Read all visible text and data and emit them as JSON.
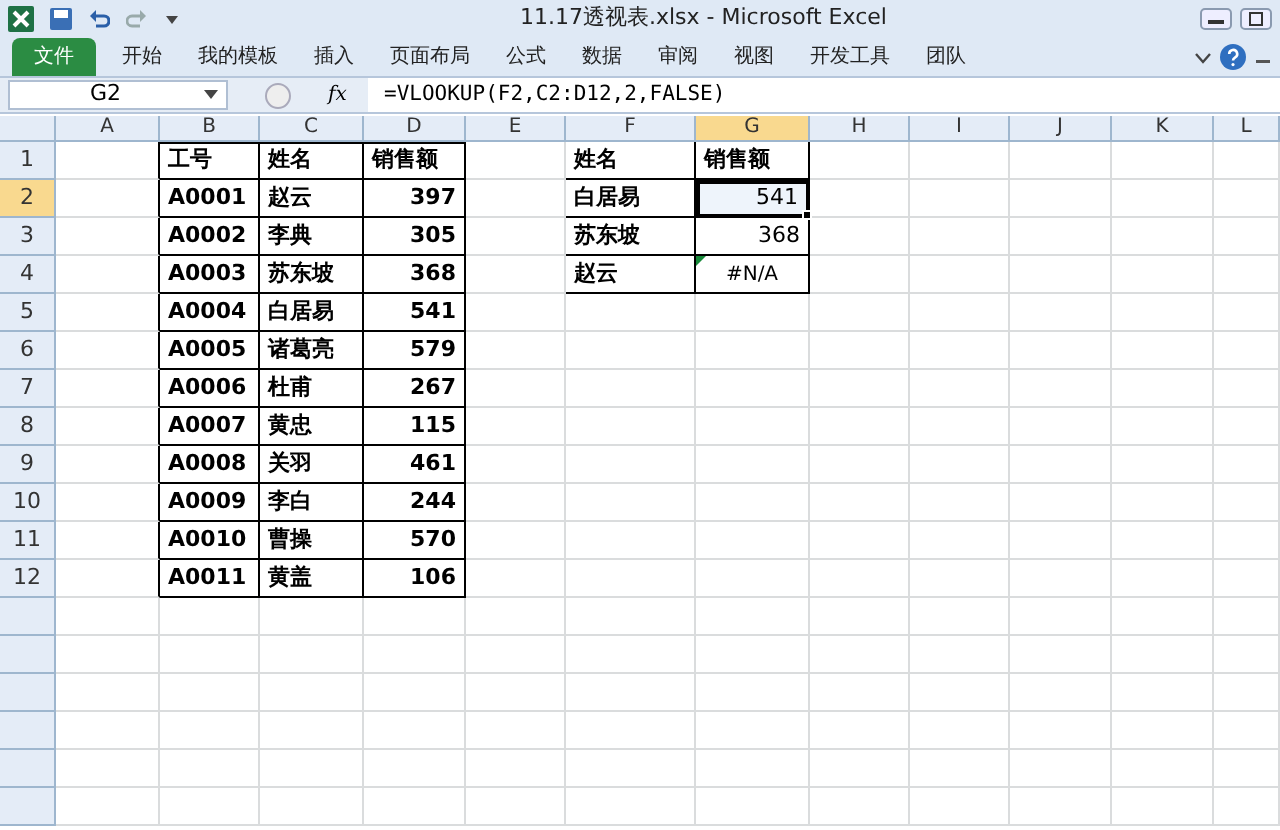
{
  "window": {
    "title": "11.17透视表.xlsx - Microsoft Excel"
  },
  "ribbon_tabs": [
    {
      "label": "文件",
      "kind": "file",
      "selected": false
    },
    {
      "label": "开始",
      "kind": "tab",
      "selected": false
    },
    {
      "label": "我的模板",
      "kind": "tab",
      "selected": false
    },
    {
      "label": "插入",
      "kind": "tab",
      "selected": false
    },
    {
      "label": "页面布局",
      "kind": "tab",
      "selected": false
    },
    {
      "label": "公式",
      "kind": "tab",
      "selected": false
    },
    {
      "label": "数据",
      "kind": "tab",
      "selected": false
    },
    {
      "label": "审阅",
      "kind": "tab",
      "selected": false
    },
    {
      "label": "视图",
      "kind": "tab",
      "selected": false
    },
    {
      "label": "开发工具",
      "kind": "tab",
      "selected": false
    },
    {
      "label": "团队",
      "kind": "tab",
      "selected": false
    }
  ],
  "formula_bar": {
    "name_box": "G2",
    "fx": "fx",
    "formula": "=VLOOKUP(F2,C2:D12,2,FALSE)"
  },
  "column_headers": [
    {
      "label": "A",
      "selected": false
    },
    {
      "label": "B",
      "selected": false
    },
    {
      "label": "C",
      "selected": false
    },
    {
      "label": "D",
      "selected": false
    },
    {
      "label": "E",
      "selected": false
    },
    {
      "label": "F",
      "selected": false
    },
    {
      "label": "G",
      "selected": true
    },
    {
      "label": "H",
      "selected": false
    },
    {
      "label": "I",
      "selected": false
    },
    {
      "label": "J",
      "selected": false
    },
    {
      "label": "K",
      "selected": false
    },
    {
      "label": "L",
      "selected": false
    }
  ],
  "row_headers": [
    {
      "label": "1",
      "selected": false
    },
    {
      "label": "2",
      "selected": true
    },
    {
      "label": "3",
      "selected": false
    },
    {
      "label": "4",
      "selected": false
    },
    {
      "label": "5",
      "selected": false
    },
    {
      "label": "6",
      "selected": false
    },
    {
      "label": "7",
      "selected": false
    },
    {
      "label": "8",
      "selected": false
    },
    {
      "label": "9",
      "selected": false
    },
    {
      "label": "10",
      "selected": false
    },
    {
      "label": "11",
      "selected": false
    },
    {
      "label": "12",
      "selected": false
    }
  ],
  "sales_table": {
    "columns": [
      "工号",
      "姓名",
      "销售额"
    ],
    "rows": [
      [
        "A0001",
        "赵云",
        "397"
      ],
      [
        "A0002",
        "李典",
        "305"
      ],
      [
        "A0003",
        "苏东坡",
        "368"
      ],
      [
        "A0004",
        "白居易",
        "541"
      ],
      [
        "A0005",
        "诸葛亮",
        "579"
      ],
      [
        "A0006",
        "杜甫",
        "267"
      ],
      [
        "A0007",
        "黄忠",
        "115"
      ],
      [
        "A0008",
        "关羽",
        "461"
      ],
      [
        "A0009",
        "李白",
        "244"
      ],
      [
        "A0010",
        "曹操",
        "570"
      ],
      [
        "A0011",
        "黄盖",
        "106"
      ]
    ]
  },
  "lookup_table": {
    "columns": [
      "姓名",
      "销售额"
    ],
    "rows": [
      {
        "name": "白居易",
        "value": "541",
        "kind": "number",
        "selected": true
      },
      {
        "name": "苏东坡",
        "value": "368",
        "kind": "number",
        "selected": false
      },
      {
        "name": "赵云",
        "value": "#N/A",
        "kind": "error",
        "selected": false
      }
    ]
  }
}
